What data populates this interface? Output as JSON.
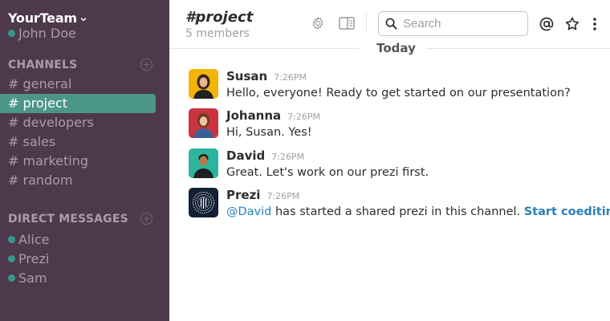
{
  "sidebar": {
    "team_name": "YourTeam",
    "user_name": "John Doe",
    "channels_header": "CHANNELS",
    "channels": [
      {
        "label": "# general",
        "active": false
      },
      {
        "label": "# project",
        "active": true
      },
      {
        "label": "# developers",
        "active": false
      },
      {
        "label": "# sales",
        "active": false
      },
      {
        "label": "# marketing",
        "active": false
      },
      {
        "label": "# random",
        "active": false
      }
    ],
    "dm_header": "DIRECT MESSAGES",
    "direct_messages": [
      "Alice",
      "Prezi",
      "Sam"
    ]
  },
  "header": {
    "channel_title": "#project",
    "member_count": "5 members",
    "search_placeholder": "Search"
  },
  "day_divider": "Today",
  "messages": [
    {
      "author": "Susan",
      "time": "7:26PM",
      "text": "Hello, everyone! Ready to get started on our presentation?"
    },
    {
      "author": "Johanna",
      "time": "7:26PM",
      "text": "Hi, Susan. Yes!"
    },
    {
      "author": "David",
      "time": "7:26PM",
      "text": "Great. Let's work on our prezi first."
    },
    {
      "author": "Prezi",
      "time": "7:26PM",
      "mention": "@David",
      "text": " has started a shared prezi in this channel. ",
      "link": "Start coediting",
      "after": "."
    }
  ],
  "colors": {
    "sidebar_bg": "#4d394b",
    "active_channel": "#4c9689",
    "presence": "#38978d",
    "link": "#2a80b9"
  },
  "icons": [
    "chevron-down-icon",
    "plus-circle-icon",
    "gear-icon",
    "sidebar-panel-icon",
    "search-icon",
    "at-icon",
    "star-icon",
    "more-vertical-icon"
  ]
}
